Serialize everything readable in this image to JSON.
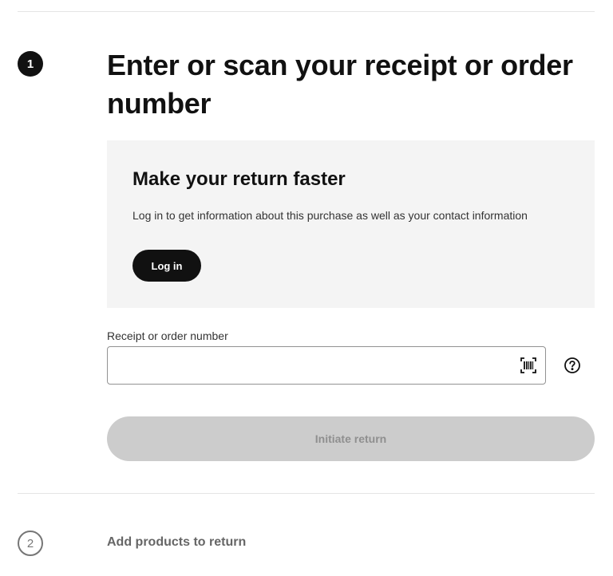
{
  "step1": {
    "number": "1",
    "title": "Enter or scan your receipt or order number"
  },
  "login_panel": {
    "heading": "Make your return faster",
    "description": "Log in to get information about this purchase as well as your contact information",
    "button_label": "Log in"
  },
  "receipt_field": {
    "label": "Receipt or order number",
    "value": "",
    "placeholder": "",
    "scan_icon": "barcode-scan-icon",
    "help_icon": "question-circle-icon"
  },
  "initiate_button": {
    "label": "Initiate return",
    "state": "disabled"
  },
  "step2": {
    "number": "2",
    "title": "Add products to return"
  },
  "colors": {
    "primary": "#111111",
    "panel_bg": "#f4f4f4",
    "disabled_bg": "#cccccc",
    "disabled_text": "#8f8f8f",
    "muted": "#666666"
  }
}
